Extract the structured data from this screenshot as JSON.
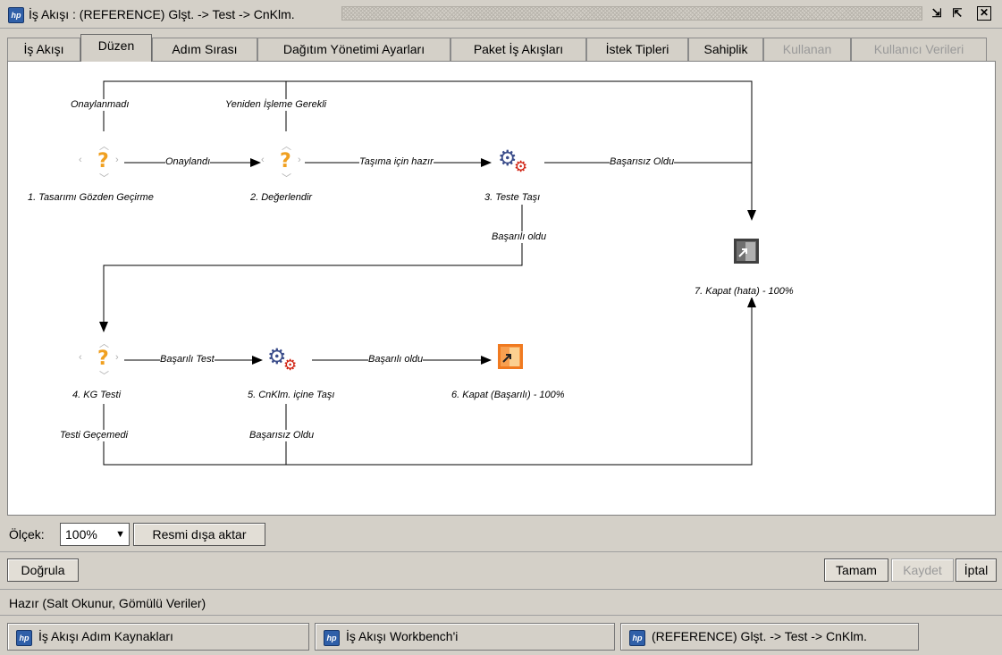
{
  "window": {
    "title": "İş Akışı : (REFERENCE) Glşt. -> Test -> CnKlm.",
    "logo": "hp-logo",
    "logo_text": "hp",
    "controls": {
      "restore": "restore-icon",
      "maximize": "maximize-icon",
      "close": "close-icon"
    }
  },
  "tabs": [
    {
      "label": "İş Akışı",
      "active": false,
      "enabled": true
    },
    {
      "label": "Düzen",
      "active": true,
      "enabled": true
    },
    {
      "label": "Adım Sırası",
      "active": false,
      "enabled": true
    },
    {
      "label": "Dağıtım Yönetimi Ayarları",
      "active": false,
      "enabled": true
    },
    {
      "label": "Paket İş Akışları",
      "active": false,
      "enabled": true
    },
    {
      "label": "İstek Tipleri",
      "active": false,
      "enabled": true
    },
    {
      "label": "Sahiplik",
      "active": false,
      "enabled": true
    },
    {
      "label": "Kullanan",
      "active": false,
      "enabled": false
    },
    {
      "label": "Kullanıcı Verileri",
      "active": false,
      "enabled": false
    }
  ],
  "diagram": {
    "nodes": [
      {
        "label": "1. Tasarımı Gözden Geçirme",
        "icon": "decision-icon"
      },
      {
        "label": "2. Değerlendir",
        "icon": "decision-icon"
      },
      {
        "label": "3. Teste Taşı",
        "icon": "gears-icon"
      },
      {
        "label": "4. KG Testi",
        "icon": "decision-icon"
      },
      {
        "label": "5. CnKlm. içine Taşı",
        "icon": "gears-icon"
      },
      {
        "label": "6. Kapat (Başarılı) - 100%",
        "icon": "close-success-icon"
      },
      {
        "label": "7. Kapat (hata) - 100%",
        "icon": "close-error-icon"
      }
    ],
    "transitions": {
      "onaylanmadi": "Onaylanmadı",
      "yeniden": "Yeniden İşleme Gerekli",
      "onaylandi": "Onaylandı",
      "tasima": "Taşıma için hazır",
      "basarisiz1": "Başarısız Oldu",
      "basarili1": "Başarılı oldu",
      "basarili_test": "Başarılı Test",
      "basarili2": "Başarılı oldu",
      "testi_gecemedi": "Testi Geçemedi",
      "basarisiz2": "Başarısız Oldu"
    }
  },
  "scale": {
    "label": "Ölçek:",
    "value": "100%"
  },
  "export_button": "Resmi dışa aktar",
  "validate_button": "Doğrula",
  "ok_button": "Tamam",
  "save_button": "Kaydet",
  "cancel_button": "İptal",
  "status": "Hazır (Salt Okunur, Gömülü Veriler)",
  "taskbar": [
    "İş Akışı Adım Kaynakları",
    "İş Akışı Workbench'i",
    "(REFERENCE) Glşt. -> Test -> CnKlm."
  ]
}
